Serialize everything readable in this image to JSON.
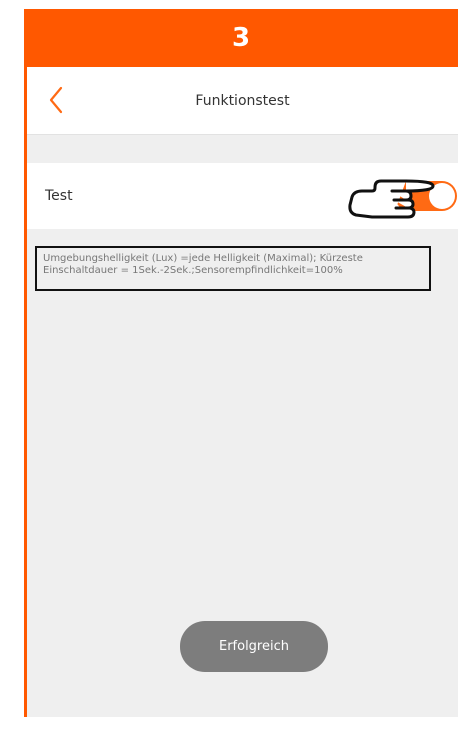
{
  "step": {
    "number": "3",
    "color": "#ff5800"
  },
  "header": {
    "back_icon": "chevron-left-icon",
    "title": "Funktionstest"
  },
  "test_row": {
    "label": "Test",
    "toggle_on": true,
    "toggle_color": "#ff6a14",
    "pointer_icon": "pointing-hand-icon"
  },
  "info": {
    "text": "Umgebungshelligkeit (Lux) =jede Helligkeit (Maximal); Kürzeste Einschaltdauer = 1Sek.-2Sek.;Sensorempfindlichkeit=100%"
  },
  "toast": {
    "text": "Erfolgreich"
  }
}
